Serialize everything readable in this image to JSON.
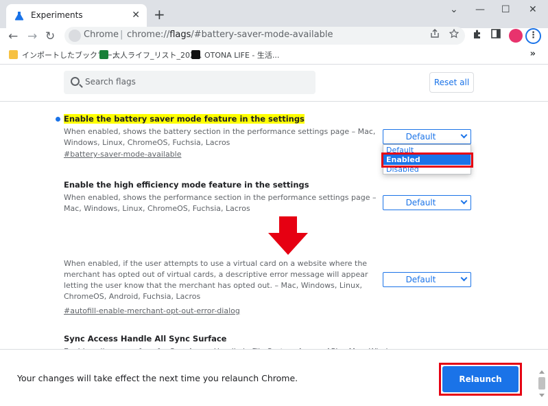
{
  "browser": {
    "tab_title": "Experiments",
    "tab_close": "✕",
    "new_tab": "+",
    "window_controls": {
      "chevron": "⌄",
      "minimize": "—",
      "maximize": "☐",
      "close": "✕"
    },
    "nav": {
      "back": "←",
      "forward": "→",
      "reload": "↻"
    },
    "omnibox": {
      "site_label": "Chrome",
      "separator": "|",
      "url_prefix": "chrome://",
      "url_emph": "flags",
      "url_suffix": "/#battery-saver-mode-available"
    },
    "toolbar_icons": [
      "share-icon",
      "star-icon",
      "puzzle-icon",
      "sidepanel-icon"
    ],
    "avatar_color": "#e8336d",
    "menu": "⋮",
    "bookmarks": [
      {
        "label": "インポートしたブックマー...",
        "icon": "folder-icon",
        "color": "#f6c142"
      },
      {
        "label": "大人ライフ_リスト_202...",
        "icon": "sheets-icon",
        "color": "#188038"
      },
      {
        "label": "OTONA LIFE - 生活...",
        "icon": "otona-life-icon",
        "color": "#111111"
      }
    ],
    "bookmarks_more": "»"
  },
  "flags_page": {
    "search_placeholder": "Search flags",
    "reset_all": "Reset all",
    "flags_top": [
      {
        "title": "Enable the battery saver mode feature in the settings",
        "description": "When enabled, shows the battery section in the performance settings page – Mac, Windows, Linux, ChromeOS, Fuchsia, Lacros",
        "link": "#battery-saver-mode-available",
        "select_value": "Default",
        "highlighted": true
      },
      {
        "title": "Enable the high efficiency mode feature in the settings",
        "description": "When enabled, shows the performance section in the performance settings page – Mac, Windows, Linux, ChromeOS, Fuchsia, Lacros",
        "select_value": "Default"
      }
    ],
    "dropdown_options": [
      "Default",
      "Enabled",
      "Disabled"
    ],
    "dropdown_selected": "Enabled",
    "flags_bottom": [
      {
        "description": "When enabled, if the user attempts to use a virtual card on a website where the merchant has opted out of virtual cards, a descriptive error message will appear letting the user know that the merchant has opted out. – Mac, Windows, Linux, ChromeOS, Android, Fuchsia, Lacros",
        "link": "#autofill-enable-merchant-opt-out-error-dialog",
        "select_value": "Default"
      },
      {
        "title": "Sync Access Handle All Sync Surface",
        "description": "Enables all sync surface for SyncAccessHandle in File System Access API. – Mac, Windows"
      }
    ],
    "relaunch_message": "Your changes will take effect the next time you relaunch Chrome.",
    "relaunch_button": "Relaunch"
  },
  "colors": {
    "accent": "#1a73e8",
    "highlight": "#ffff00",
    "annotation_red": "#e60012"
  }
}
